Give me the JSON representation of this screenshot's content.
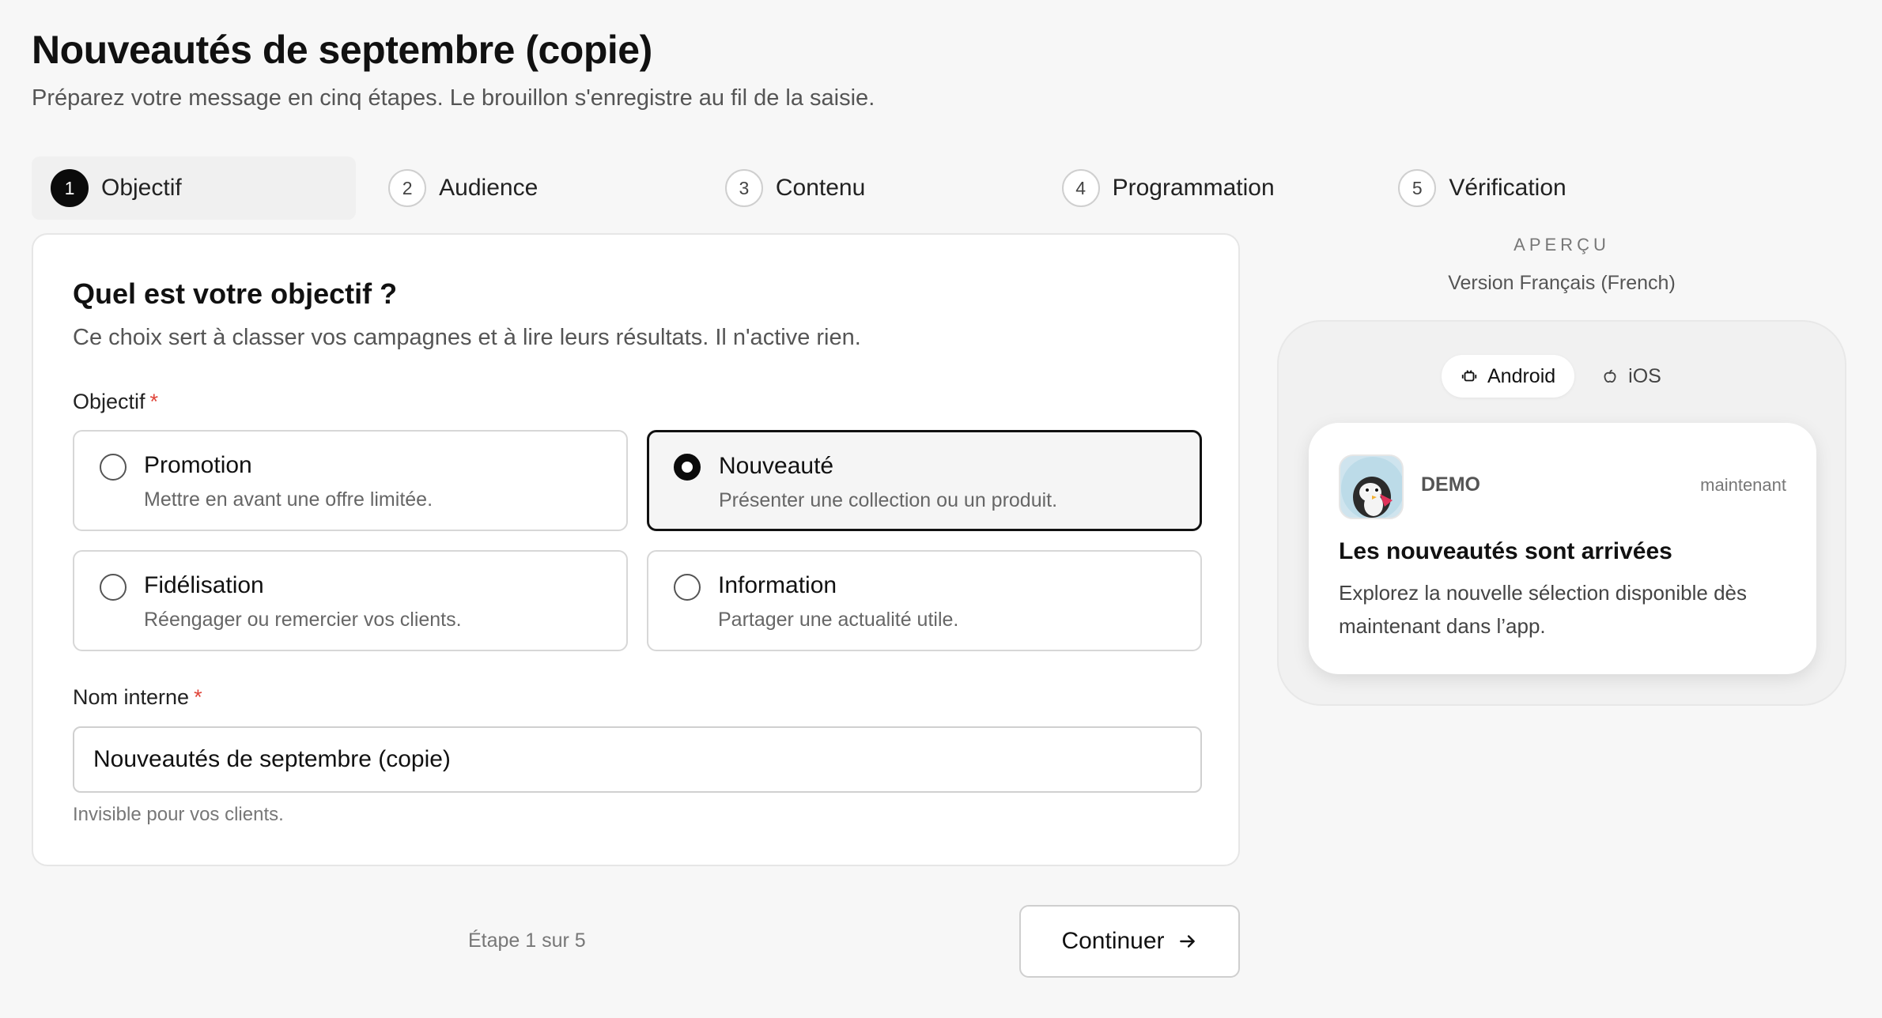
{
  "header": {
    "title": "Nouveautés de septembre (copie)",
    "subtitle": "Préparez votre message en cinq étapes. Le brouillon s'enregistre au fil de la saisie."
  },
  "stepper": {
    "steps": [
      {
        "num": "1",
        "label": "Objectif",
        "active": true
      },
      {
        "num": "2",
        "label": "Audience"
      },
      {
        "num": "3",
        "label": "Contenu"
      },
      {
        "num": "4",
        "label": "Programmation"
      },
      {
        "num": "5",
        "label": "Vérification"
      }
    ]
  },
  "form": {
    "heading": "Quel est votre objectif ?",
    "description": "Ce choix sert à classer vos campagnes et à lire leurs résultats. Il n'active rien.",
    "objective_label": "Objectif",
    "required_mark": "*",
    "options": [
      {
        "title": "Promotion",
        "desc": "Mettre en avant une offre limitée.",
        "selected": false
      },
      {
        "title": "Nouveauté",
        "desc": "Présenter une collection ou un produit.",
        "selected": true
      },
      {
        "title": "Fidélisation",
        "desc": "Réengager ou remercier vos clients.",
        "selected": false
      },
      {
        "title": "Information",
        "desc": "Partager une actualité utile.",
        "selected": false
      }
    ],
    "internal_name_label": "Nom interne",
    "internal_name_value": "Nouveautés de septembre (copie)",
    "internal_name_help": "Invisible pour vos clients."
  },
  "footer": {
    "step_counter": "Étape 1 sur 5",
    "continue_label": "Continuer",
    "continue_icon": "arrow-right-icon"
  },
  "preview": {
    "eyebrow": "APERÇU",
    "version": "Version Français (French)",
    "platforms": [
      {
        "label": "Android",
        "icon": "android-icon",
        "active": true
      },
      {
        "label": "iOS",
        "icon": "apple-icon",
        "active": false
      }
    ],
    "notification": {
      "app_name": "DEMO",
      "time": "maintenant",
      "title": "Les nouveautés sont arrivées",
      "body": "Explorez la nouvelle sélection disponible dès maintenant dans l’app."
    }
  },
  "colors": {
    "accent": "#0b0b0b",
    "required": "#e0453a",
    "background": "#f7f7f7"
  }
}
